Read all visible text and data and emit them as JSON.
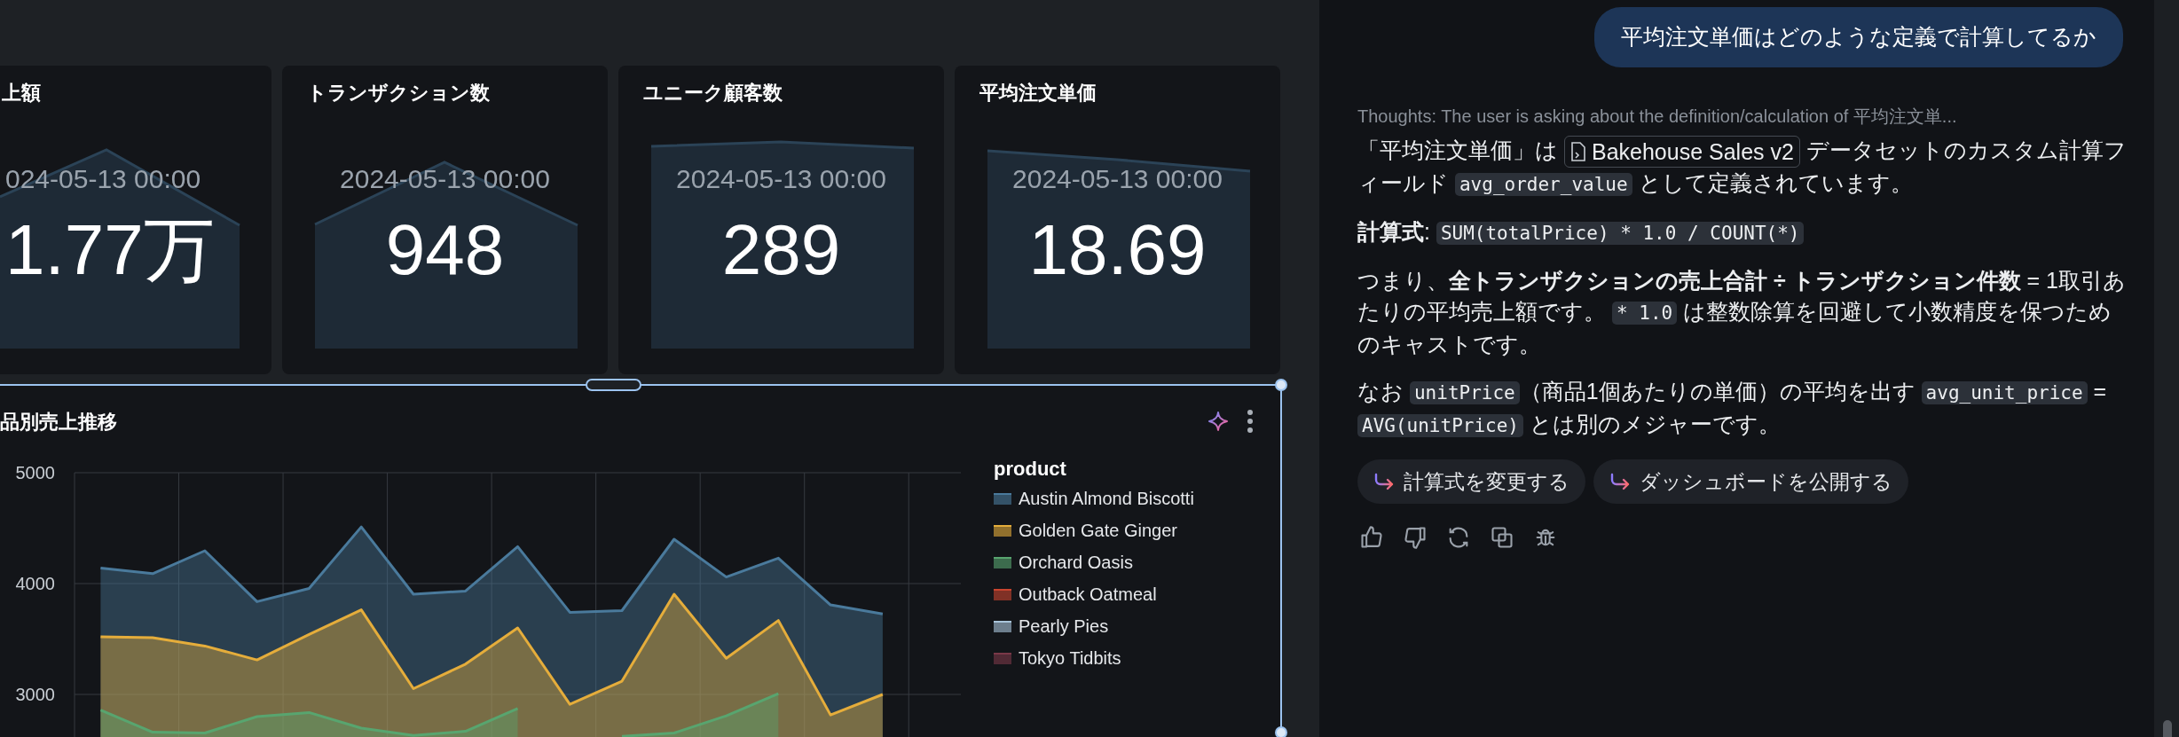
{
  "dashboard": {
    "kpi_cards": [
      {
        "title": "上額",
        "date": "024-05-13 00:00",
        "value": "1.77万"
      },
      {
        "title": "トランザクション数",
        "date": "2024-05-13 00:00",
        "value": "948"
      },
      {
        "title": "ユニーク顧客数",
        "date": "2024-05-13 00:00",
        "value": "289"
      },
      {
        "title": "平均注文単価",
        "date": "2024-05-13 00:00",
        "value": "18.69"
      }
    ],
    "chart_panel": {
      "title": "品別売上推移",
      "selected": true,
      "legend_title": "product",
      "chart_data": {
        "type": "area",
        "ylim": [
          2600,
          5000
        ],
        "yticks": [
          3000,
          4000,
          5000
        ],
        "series": [
          {
            "name": "Austin Almond Biscotti",
            "color": "#4a7a9c",
            "values": [
              4140,
              4090,
              4296,
              3837,
              3956,
              4511,
              3904,
              3933,
              4333,
              3741,
              3756,
              4400,
              4059,
              4230,
              3807,
              3726,
              null
            ]
          },
          {
            "name": "Golden Gate Ginger",
            "color": "#e5ad3b",
            "values": [
              3519,
              3511,
              3437,
              3311,
              3541,
              3763,
              3052,
              3274,
              3600,
              2911,
              3119,
              3904,
              3326,
              3667,
              2815,
              3000,
              null
            ]
          },
          {
            "name": "Orchard Oasis",
            "color": "#58a56f",
            "values": [
              2859,
              2659,
              2652,
              2800,
              2837,
              2696,
              2630,
              2667,
              2874,
              null,
              2622,
              2652,
              2807,
              3007,
              null,
              null,
              null
            ]
          },
          {
            "name": "Outback Oatmeal",
            "color": "#c9442e",
            "values": [
              null,
              null,
              null,
              null,
              null,
              null,
              null,
              null,
              null,
              null,
              null,
              null,
              null,
              null,
              null,
              null,
              null
            ]
          },
          {
            "name": "Pearly Pies",
            "color": "#a9c4da",
            "values": [
              null,
              null,
              null,
              null,
              null,
              null,
              null,
              null,
              null,
              null,
              null,
              null,
              null,
              null,
              null,
              null,
              null
            ]
          },
          {
            "name": "Tokyo Tidbits",
            "color": "#7a3848",
            "values": [
              null,
              null,
              null,
              null,
              null,
              null,
              null,
              null,
              null,
              null,
              null,
              null,
              null,
              null,
              null,
              null,
              null
            ]
          }
        ]
      }
    }
  },
  "assistant": {
    "user_message": "平均注文単価はどのような定義で計算してるか",
    "thoughts": "Thoughts: The user is asking about the definition/calculation of 平均注文単...",
    "answer": [
      [
        {
          "kind": "text",
          "text": "「平均注文単価」は "
        },
        {
          "kind": "dataset",
          "text": "Bakehouse Sales v2"
        },
        {
          "kind": "text",
          "text": " データセットのカスタム計算フィールド "
        },
        {
          "kind": "code",
          "text": "avg_order_value"
        },
        {
          "kind": "text",
          "text": " として定義されています。"
        }
      ],
      [
        {
          "kind": "bold",
          "text": "計算式"
        },
        {
          "kind": "text",
          "text": ": "
        },
        {
          "kind": "code",
          "text": "SUM(totalPrice) * 1.0 / COUNT(*)"
        }
      ],
      [
        {
          "kind": "text",
          "text": "つまり、"
        },
        {
          "kind": "bold",
          "text": "全トランザクションの売上合計 ÷ トランザクション件数"
        },
        {
          "kind": "text",
          "text": " = 1取引あたりの平均売上額です。 "
        },
        {
          "kind": "code",
          "text": "* 1.0"
        },
        {
          "kind": "text",
          "text": " は整数除算を回避して小数精度を保つためのキャストです。"
        }
      ],
      [
        {
          "kind": "text",
          "text": "なお "
        },
        {
          "kind": "code",
          "text": "unitPrice"
        },
        {
          "kind": "text",
          "text": "（商品1個あたりの単価）の平均を出す "
        },
        {
          "kind": "code",
          "text": "avg_unit_price"
        },
        {
          "kind": "text",
          "text": " = "
        },
        {
          "kind": "code",
          "text": "AVG(unitPrice)"
        },
        {
          "kind": "text",
          "text": " とは別のメジャーです。"
        }
      ]
    ],
    "suggestions": [
      "計算式を変更する",
      "ダッシュボードを公開する"
    ]
  }
}
